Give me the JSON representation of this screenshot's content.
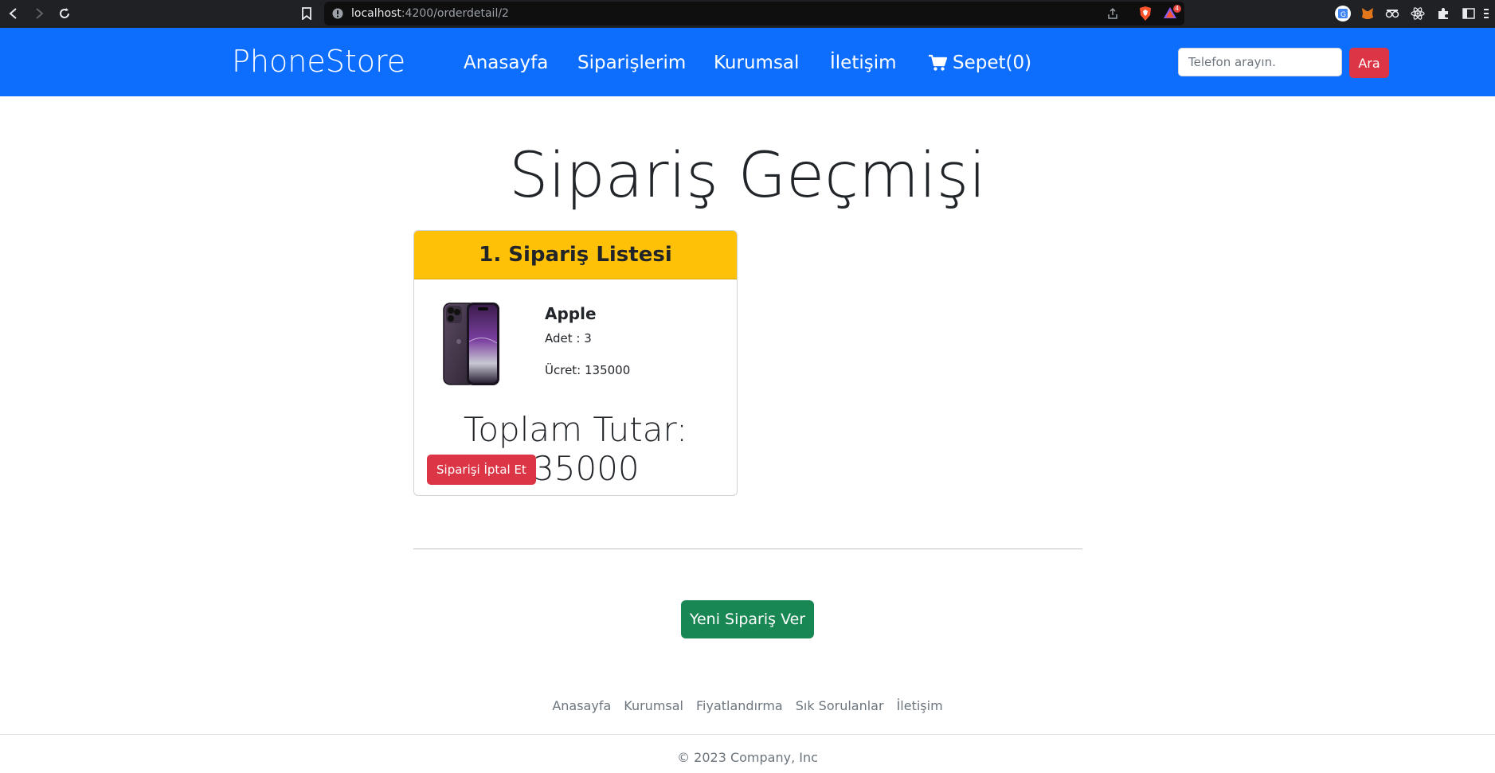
{
  "browser": {
    "url_host": "localhost",
    "url_path": ":4200/orderdetail/2",
    "extension_badge": "4"
  },
  "navbar": {
    "brand": "PhoneStore",
    "links": [
      "Anasayfa",
      "Siparişlerim",
      "Kurumsal",
      "İletişim",
      "Sepet(0)"
    ],
    "search_placeholder": "Telefon arayın.",
    "search_button": "Ara"
  },
  "page": {
    "title": "Sipariş Geçmişi"
  },
  "order": {
    "header": "1. Sipariş Listesi",
    "item": {
      "brand": "Apple",
      "quantity_text": "Adet : 3",
      "price_text": "Ücret: 135000"
    },
    "total_text": "Toplam Tutar: 135000",
    "cancel_button": "Siparişi İptal Et"
  },
  "new_order_button": "Yeni Sipariş Ver",
  "footer": {
    "links": [
      "Anasayfa",
      "Kurumsal",
      "Fiyatlandırma",
      "Sık Sorulanlar",
      "İletişim"
    ],
    "copyright": "© 2023 Company, Inc"
  },
  "colors": {
    "navbar": "#0d6efd",
    "danger": "#dc3545",
    "warning": "#ffc107",
    "success": "#198754"
  }
}
